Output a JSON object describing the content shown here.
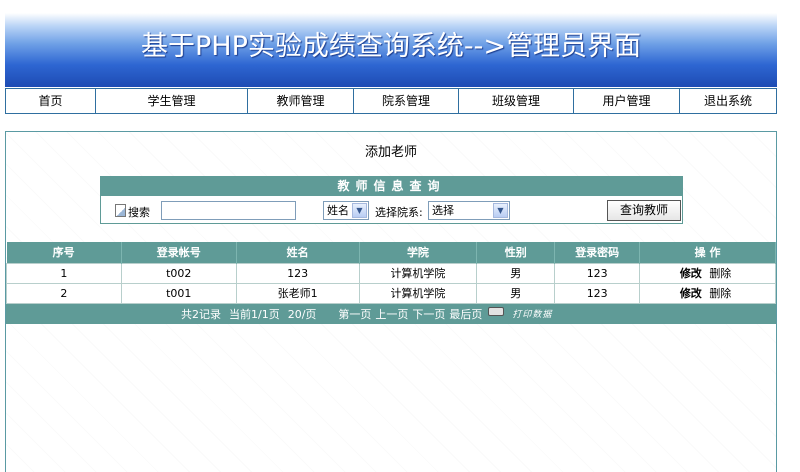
{
  "header": {
    "title": "基于PHP实验成绩查询系统-->管理员界面"
  },
  "nav": {
    "items": [
      {
        "label": "首页"
      },
      {
        "label": "学生管理"
      },
      {
        "label": "教师管理"
      },
      {
        "label": "院系管理"
      },
      {
        "label": "班级管理"
      },
      {
        "label": "用户管理"
      },
      {
        "label": "退出系统"
      }
    ]
  },
  "main": {
    "title": "添加老师",
    "search": {
      "heading": "教师信息查询",
      "search_label": "搜索",
      "input_value": "",
      "field_selected": "姓名",
      "college_label": "选择院系:",
      "college_selected": "选择",
      "query_button": "查询教师"
    },
    "table": {
      "headers": [
        "序号",
        "登录帐号",
        "姓名",
        "学院",
        "性别",
        "登录密码",
        "操 作"
      ],
      "rows": [
        {
          "no": "1",
          "account": "t002",
          "name": "123",
          "college": "计算机学院",
          "gender": "男",
          "password": "123",
          "edit": "修改",
          "delete": "删除"
        },
        {
          "no": "2",
          "account": "t001",
          "name": "张老师1",
          "college": "计算机学院",
          "gender": "男",
          "password": "123",
          "edit": "修改",
          "delete": "删除"
        }
      ]
    },
    "pager": {
      "total": "共2记录",
      "current": "当前1/1页",
      "per_page": "20/页",
      "first": "第一页",
      "prev": "上一页",
      "next": "下一页",
      "last": "最后页",
      "print": "打印数据"
    }
  }
}
